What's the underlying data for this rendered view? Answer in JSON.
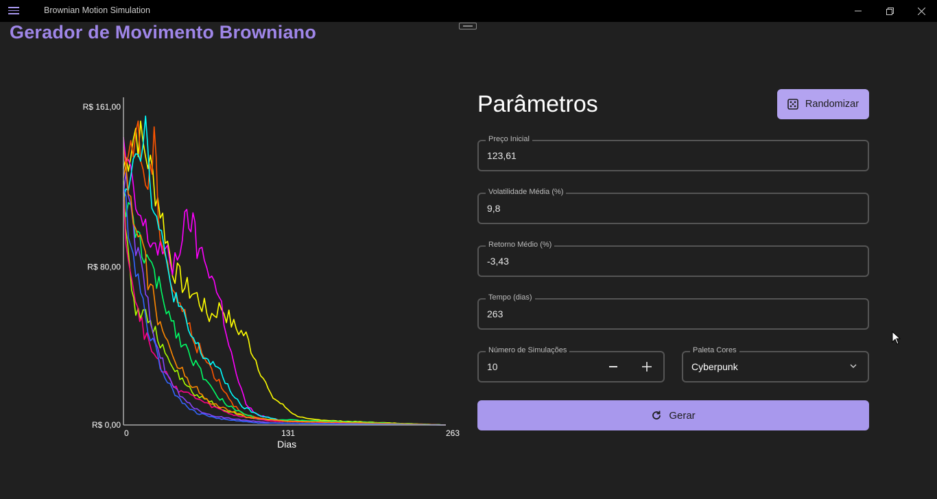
{
  "window": {
    "title": "Brownian Motion Simulation",
    "controls": [
      "minimize",
      "restore",
      "close"
    ]
  },
  "page": {
    "title": "Gerador de Movimento Browniano"
  },
  "params": {
    "title": "Parâmetros",
    "randomize_label": "Randomizar",
    "fields": {
      "initial_price": {
        "label": "Preço Inicial",
        "value": "123,61"
      },
      "volatility": {
        "label": "Volatilidade Média (%)",
        "value": "9,8"
      },
      "return": {
        "label": "Retorno Médio (%)",
        "value": "-3,43"
      },
      "time": {
        "label": "Tempo (dias)",
        "value": "263"
      },
      "simulations": {
        "label": "Número de Simulações",
        "value": "10"
      },
      "palette": {
        "label": "Paleta Cores",
        "value": "Cyberpunk"
      }
    },
    "generate_label": "Gerar"
  },
  "chart_data": {
    "type": "line",
    "xlabel": "Dias",
    "ylabel": "",
    "xlim": [
      0,
      263
    ],
    "ylim": [
      0,
      161
    ],
    "x_ticks": [
      0,
      131,
      263
    ],
    "y_tick_values": [
      0,
      80,
      161
    ],
    "y_tick_labels": [
      "R$ 0,00",
      "R$ 80,00",
      "R$ 161,00"
    ],
    "series": [
      {
        "color": "#ffff00",
        "points": [
          [
            0,
            130
          ],
          [
            10,
            150
          ],
          [
            20,
            135
          ],
          [
            30,
            110
          ],
          [
            40,
            80
          ],
          [
            50,
            70
          ],
          [
            60,
            65
          ],
          [
            70,
            55
          ],
          [
            80,
            60
          ],
          [
            90,
            50
          ],
          [
            100,
            45
          ],
          [
            110,
            30
          ],
          [
            120,
            15
          ],
          [
            130,
            10
          ],
          [
            140,
            5
          ],
          [
            150,
            3
          ],
          [
            175,
            2
          ],
          [
            263,
            0
          ]
        ]
      },
      {
        "color": "#ff00ff",
        "points": [
          [
            0,
            140
          ],
          [
            10,
            110
          ],
          [
            20,
            95
          ],
          [
            30,
            90
          ],
          [
            40,
            80
          ],
          [
            50,
            100
          ],
          [
            55,
            105
          ],
          [
            60,
            90
          ],
          [
            70,
            80
          ],
          [
            80,
            60
          ],
          [
            90,
            30
          ],
          [
            100,
            10
          ],
          [
            110,
            5
          ],
          [
            130,
            2
          ],
          [
            263,
            0
          ]
        ]
      },
      {
        "color": "#ff5500",
        "points": [
          [
            0,
            130
          ],
          [
            10,
            150
          ],
          [
            20,
            120
          ],
          [
            25,
            140
          ],
          [
            30,
            100
          ],
          [
            40,
            70
          ],
          [
            50,
            55
          ],
          [
            60,
            40
          ],
          [
            70,
            30
          ],
          [
            80,
            20
          ],
          [
            90,
            10
          ],
          [
            100,
            5
          ],
          [
            120,
            2
          ],
          [
            263,
            0
          ]
        ]
      },
      {
        "color": "#00ffff",
        "points": [
          [
            0,
            120
          ],
          [
            10,
            140
          ],
          [
            18,
            150
          ],
          [
            25,
            110
          ],
          [
            35,
            80
          ],
          [
            45,
            60
          ],
          [
            55,
            45
          ],
          [
            65,
            35
          ],
          [
            75,
            30
          ],
          [
            85,
            20
          ],
          [
            95,
            10
          ],
          [
            110,
            5
          ],
          [
            130,
            2
          ],
          [
            263,
            0
          ]
        ]
      },
      {
        "color": "#00ff66",
        "points": [
          [
            0,
            115
          ],
          [
            8,
            100
          ],
          [
            15,
            90
          ],
          [
            25,
            75
          ],
          [
            35,
            60
          ],
          [
            45,
            45
          ],
          [
            55,
            35
          ],
          [
            65,
            25
          ],
          [
            75,
            15
          ],
          [
            90,
            8
          ],
          [
            110,
            3
          ],
          [
            263,
            0
          ]
        ]
      },
      {
        "color": "#aaff00",
        "points": [
          [
            0,
            120
          ],
          [
            5,
            80
          ],
          [
            10,
            60
          ],
          [
            20,
            55
          ],
          [
            30,
            40
          ],
          [
            40,
            30
          ],
          [
            50,
            20
          ],
          [
            60,
            15
          ],
          [
            70,
            12
          ],
          [
            80,
            8
          ],
          [
            100,
            4
          ],
          [
            130,
            2
          ],
          [
            263,
            0
          ]
        ]
      },
      {
        "color": "#ff0088",
        "points": [
          [
            0,
            110
          ],
          [
            8,
            70
          ],
          [
            15,
            50
          ],
          [
            25,
            35
          ],
          [
            35,
            25
          ],
          [
            45,
            18
          ],
          [
            55,
            15
          ],
          [
            70,
            10
          ],
          [
            90,
            5
          ],
          [
            120,
            2
          ],
          [
            263,
            0
          ]
        ]
      },
      {
        "color": "#8844ff",
        "points": [
          [
            0,
            125
          ],
          [
            10,
            90
          ],
          [
            20,
            60
          ],
          [
            30,
            35
          ],
          [
            40,
            20
          ],
          [
            50,
            12
          ],
          [
            60,
            8
          ],
          [
            70,
            5
          ],
          [
            90,
            3
          ],
          [
            120,
            1
          ],
          [
            263,
            0
          ]
        ]
      },
      {
        "color": "#ff8800",
        "points": [
          [
            0,
            128
          ],
          [
            10,
            105
          ],
          [
            20,
            75
          ],
          [
            30,
            50
          ],
          [
            40,
            35
          ],
          [
            50,
            25
          ],
          [
            60,
            18
          ],
          [
            70,
            12
          ],
          [
            85,
            8
          ],
          [
            100,
            4
          ],
          [
            130,
            2
          ],
          [
            263,
            0
          ]
        ]
      },
      {
        "color": "#3366ff",
        "points": [
          [
            0,
            118
          ],
          [
            10,
            80
          ],
          [
            20,
            50
          ],
          [
            30,
            30
          ],
          [
            40,
            18
          ],
          [
            50,
            10
          ],
          [
            60,
            6
          ],
          [
            80,
            3
          ],
          [
            110,
            1
          ],
          [
            263,
            0
          ]
        ]
      }
    ]
  }
}
